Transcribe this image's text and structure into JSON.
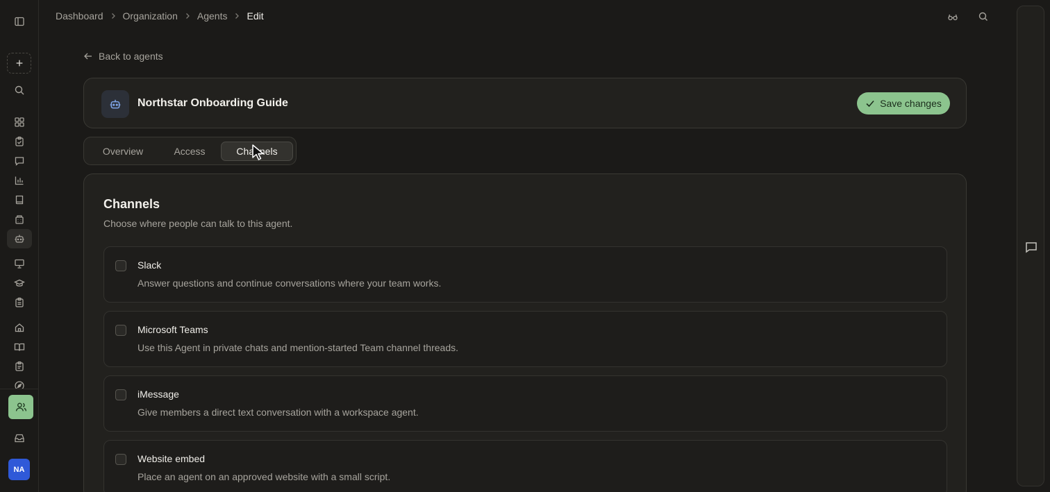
{
  "breadcrumb": [
    "Dashboard",
    "Organization",
    "Agents",
    "Edit"
  ],
  "back_label": "Back to agents",
  "agent": {
    "name": "Northstar Onboarding Guide"
  },
  "save_label": "Save changes",
  "tabs": [
    {
      "label": "Overview"
    },
    {
      "label": "Access"
    },
    {
      "label": "Channels",
      "active": true
    }
  ],
  "channels_section": {
    "title": "Channels",
    "subtitle": "Choose where people can talk to this agent.",
    "items": [
      {
        "name": "Slack",
        "description": "Answer questions and continue conversations where your team works.",
        "checked": false
      },
      {
        "name": "Microsoft Teams",
        "description": "Use this Agent in private chats and mention-started Team channel threads.",
        "checked": false
      },
      {
        "name": "iMessage",
        "description": "Give members a direct text conversation with a workspace agent.",
        "checked": false
      },
      {
        "name": "Website embed",
        "description": "Place an agent on an approved website with a small script.",
        "checked": false
      }
    ]
  },
  "user": {
    "initials": "NA"
  },
  "colors": {
    "accent": "#8cc48e",
    "avatar": "#2f59d8",
    "background": "#1b1a18",
    "card": "#22211e"
  },
  "icons": [
    "sidebar-toggle-icon",
    "plus-icon",
    "search-icon",
    "dashboard-icon",
    "clipboard-check-icon",
    "message-icon",
    "bar-chart-icon",
    "book-icon",
    "building-icon",
    "bot-icon",
    "presentation-icon",
    "graduation-cap-icon",
    "clipboard-list-icon",
    "home-icon",
    "book-open-icon",
    "clipboard-icon",
    "compass-icon",
    "users-icon",
    "inbox-icon",
    "glasses-icon",
    "chat-icon",
    "arrow-left-icon",
    "check-icon"
  ]
}
